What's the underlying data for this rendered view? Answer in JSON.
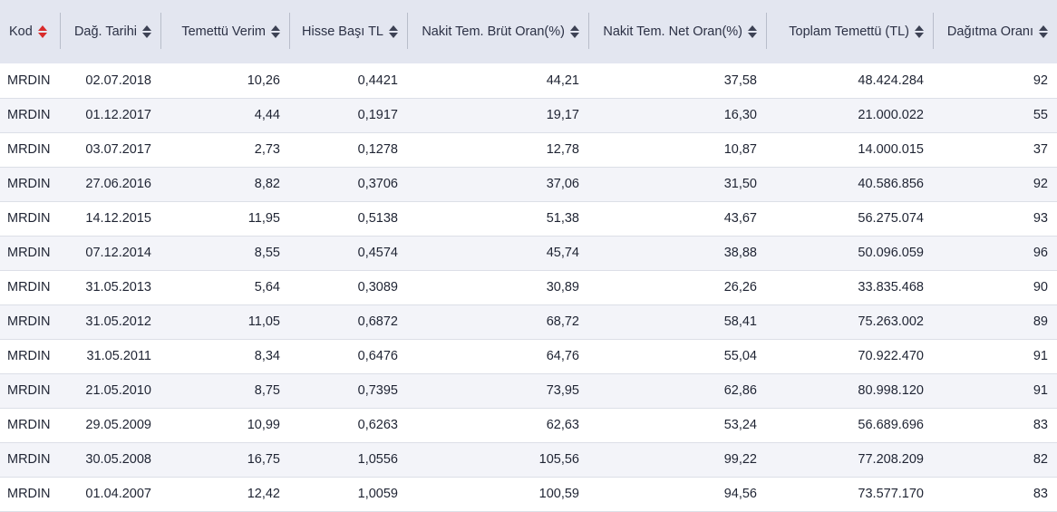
{
  "table": {
    "columns": [
      {
        "label": "Kod",
        "sort_active": true
      },
      {
        "label": "Dağ. Tarihi",
        "sort_active": false
      },
      {
        "label": "Temettü Verim",
        "sort_active": false
      },
      {
        "label": "Hisse Başı TL",
        "sort_active": false
      },
      {
        "label": "Nakit Tem. Brüt Oran(%)",
        "sort_active": false
      },
      {
        "label": "Nakit Tem. Net Oran(%)",
        "sort_active": false
      },
      {
        "label": "Toplam Temettü (TL)",
        "sort_active": false
      },
      {
        "label": "Dağıtma Oranı",
        "sort_active": false
      }
    ],
    "rows": [
      [
        "MRDIN",
        "02.07.2018",
        "10,26",
        "0,4421",
        "44,21",
        "37,58",
        "48.424.284",
        "92"
      ],
      [
        "MRDIN",
        "01.12.2017",
        "4,44",
        "0,1917",
        "19,17",
        "16,30",
        "21.000.022",
        "55"
      ],
      [
        "MRDIN",
        "03.07.2017",
        "2,73",
        "0,1278",
        "12,78",
        "10,87",
        "14.000.015",
        "37"
      ],
      [
        "MRDIN",
        "27.06.2016",
        "8,82",
        "0,3706",
        "37,06",
        "31,50",
        "40.586.856",
        "92"
      ],
      [
        "MRDIN",
        "14.12.2015",
        "11,95",
        "0,5138",
        "51,38",
        "43,67",
        "56.275.074",
        "93"
      ],
      [
        "MRDIN",
        "07.12.2014",
        "8,55",
        "0,4574",
        "45,74",
        "38,88",
        "50.096.059",
        "96"
      ],
      [
        "MRDIN",
        "31.05.2013",
        "5,64",
        "0,3089",
        "30,89",
        "26,26",
        "33.835.468",
        "90"
      ],
      [
        "MRDIN",
        "31.05.2012",
        "11,05",
        "0,6872",
        "68,72",
        "58,41",
        "75.263.002",
        "89"
      ],
      [
        "MRDIN",
        "31.05.2011",
        "8,34",
        "0,6476",
        "64,76",
        "55,04",
        "70.922.470",
        "91"
      ],
      [
        "MRDIN",
        "21.05.2010",
        "8,75",
        "0,7395",
        "73,95",
        "62,86",
        "80.998.120",
        "91"
      ],
      [
        "MRDIN",
        "29.05.2009",
        "10,99",
        "0,6263",
        "62,63",
        "53,24",
        "56.689.696",
        "83"
      ],
      [
        "MRDIN",
        "30.05.2008",
        "16,75",
        "1,0556",
        "105,56",
        "99,22",
        "77.208.209",
        "82"
      ],
      [
        "MRDIN",
        "01.04.2007",
        "12,42",
        "1,0059",
        "100,59",
        "94,56",
        "73.577.170",
        "83"
      ]
    ]
  },
  "colors": {
    "header_bg": "#e3e6f0",
    "row_alt_bg": "#f3f4f9",
    "sort_active": "#d92b2b",
    "text": "#1f2433"
  }
}
